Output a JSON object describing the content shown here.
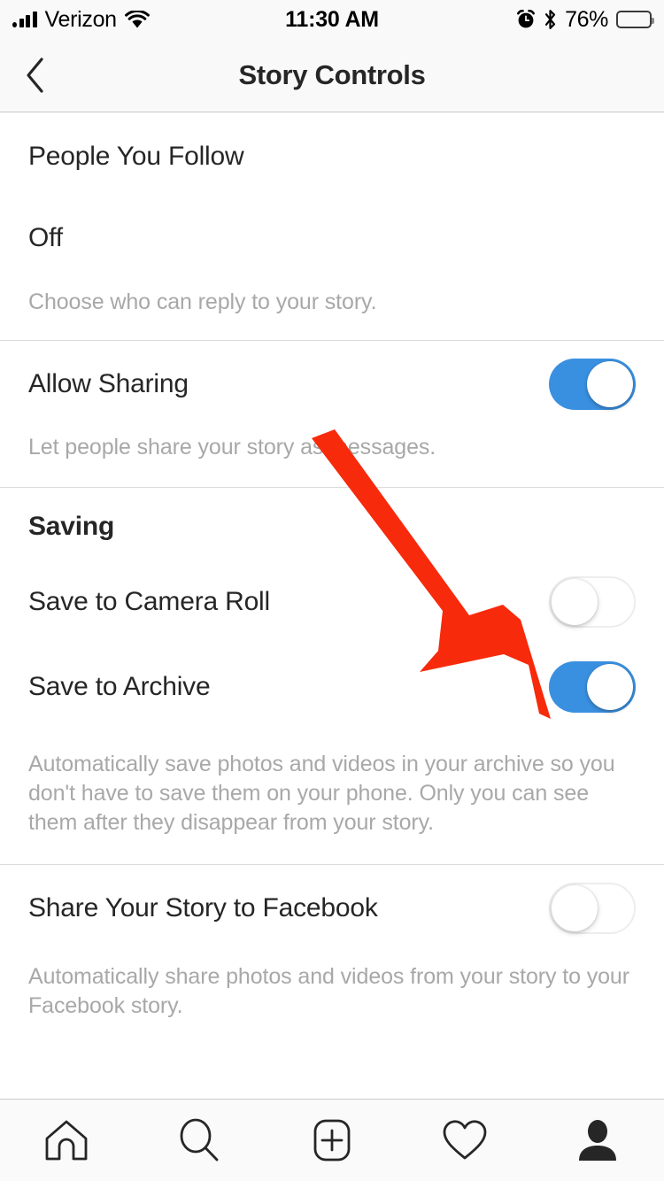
{
  "status_bar": {
    "carrier": "Verizon",
    "time": "11:30 AM",
    "battery_percent": "76%",
    "signal_icon": "signal-bars-icon",
    "wifi_icon": "wifi-icon",
    "alarm_icon": "alarm-clock-icon",
    "bluetooth_icon": "bluetooth-icon",
    "battery_icon": "battery-icon"
  },
  "nav_bar": {
    "back_icon": "chevron-left-icon",
    "title": "Story Controls"
  },
  "sections": [
    {
      "name": "replying",
      "rows": [
        {
          "label": "People You Follow",
          "type": "text"
        },
        {
          "label": "Off",
          "type": "text"
        }
      ],
      "description": "Choose who can reply to your story."
    },
    {
      "name": "allow-sharing",
      "rows": [
        {
          "label": "Allow Sharing",
          "type": "toggle",
          "state": "on"
        }
      ],
      "description": "Let people share your story as messages."
    },
    {
      "name": "saving",
      "header": "Saving",
      "rows": [
        {
          "label": "Save to Camera Roll",
          "type": "toggle",
          "state": "off"
        },
        {
          "label": "Save to Archive",
          "type": "toggle",
          "state": "on"
        }
      ],
      "description": "Automatically save photos and videos in your archive so you don't have to save them on your phone. Only you can see them after they disappear from your story."
    },
    {
      "name": "share-to-facebook",
      "rows": [
        {
          "label": "Share Your Story to Facebook",
          "type": "toggle",
          "state": "off"
        }
      ],
      "description": "Automatically share photos and videos from your story to your Facebook story."
    }
  ],
  "annotation": {
    "arrow_color": "#F72A0B",
    "arrow_target": "save-to-archive-toggle"
  },
  "tab_bar": {
    "items": [
      {
        "icon": "home-icon",
        "name": "tab-home"
      },
      {
        "icon": "search-icon",
        "name": "tab-search"
      },
      {
        "icon": "add-post-icon",
        "name": "tab-add"
      },
      {
        "icon": "heart-icon",
        "name": "tab-activity"
      },
      {
        "icon": "profile-icon",
        "name": "tab-profile"
      }
    ]
  },
  "colors": {
    "toggle_on": "#3A90E0",
    "text_primary": "#262626",
    "text_secondary": "#A8A8A8",
    "divider": "#DBDBDB",
    "bar_background": "#F9F9F9"
  }
}
